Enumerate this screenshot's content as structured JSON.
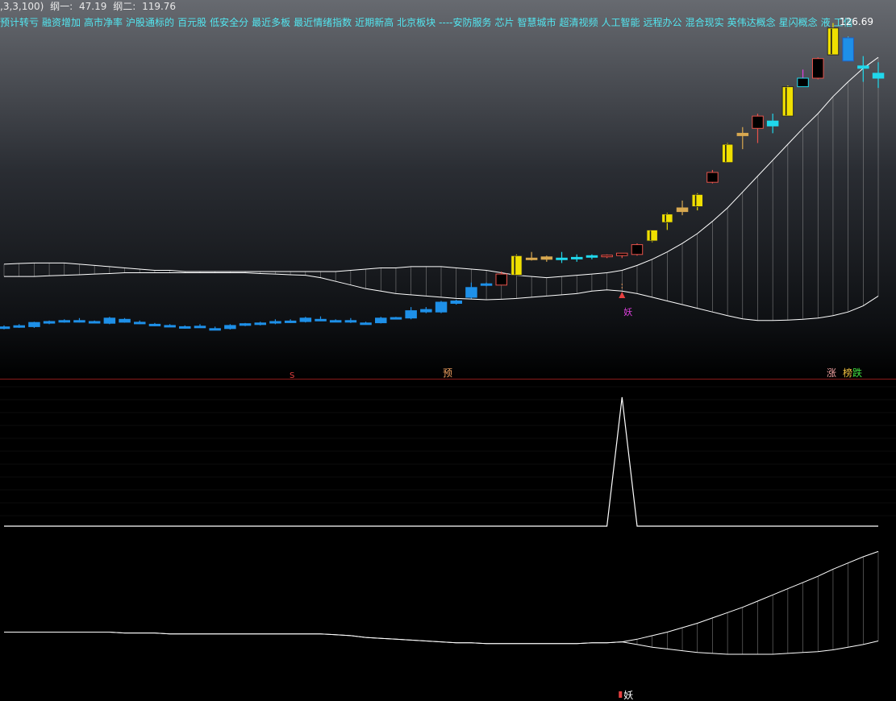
{
  "header": {
    "params": ",3,3,100)",
    "line1_label": "纲一:",
    "line1_value": "47.19",
    "line2_label": "纲二:",
    "line2_value": "119.76"
  },
  "tags": [
    "预计转亏",
    "融资增加",
    "高市净率",
    "沪股通标的",
    "百元股",
    "低安全分",
    "最近多板",
    "最近情绪指数",
    "近期新高",
    "北京板块",
    "----安防服务",
    "芯片",
    "智慧城市",
    "超清视频",
    "人工智能",
    "远程办公",
    "混合现实",
    "英伟达概念",
    "星闪概念",
    "液",
    "工信"
  ],
  "colors": {
    "up_candle": "#f0e000",
    "down_candle": "#e8524a",
    "pre_candle": "#1e90e8",
    "cyan_candle": "#20d8ec",
    "tan_candle": "#d8a850",
    "band_line": "#ffffff",
    "marker_magenta": "#e040e0",
    "marker_red": "#e84040",
    "marker_orange": "#f0a060"
  },
  "markers": {
    "yao_main": "妖",
    "s": "S",
    "yu": "预",
    "zhang": "涨",
    "bang": "榜",
    "die": "跌",
    "yao_bottom": "妖",
    "price_label": "126.69"
  },
  "chart_data": [
    {
      "type": "candlestick",
      "panel": "main",
      "ylim": [
        0,
        130
      ],
      "candles": [
        {
          "o": 7.6,
          "h": 8.6,
          "l": 7.0,
          "c": 8.0,
          "style": "pre"
        },
        {
          "o": 8.1,
          "h": 9.1,
          "l": 7.6,
          "c": 8.5,
          "style": "pre"
        },
        {
          "o": 8.1,
          "h": 10.1,
          "l": 7.6,
          "c": 9.8,
          "style": "pre"
        },
        {
          "o": 9.5,
          "h": 10.6,
          "l": 9.1,
          "c": 10.2,
          "style": "pre"
        },
        {
          "o": 10.2,
          "h": 11.1,
          "l": 9.7,
          "c": 10.6,
          "style": "pre"
        },
        {
          "o": 10.6,
          "h": 11.6,
          "l": 9.8,
          "c": 10.0,
          "style": "pre"
        },
        {
          "o": 9.9,
          "h": 10.6,
          "l": 9.5,
          "c": 10.2,
          "style": "pre"
        },
        {
          "o": 9.5,
          "h": 12.1,
          "l": 9.1,
          "c": 11.6,
          "style": "pre"
        },
        {
          "o": 9.9,
          "h": 11.6,
          "l": 9.7,
          "c": 11.1,
          "style": "pre"
        },
        {
          "o": 9.7,
          "h": 10.6,
          "l": 9.1,
          "c": 9.9,
          "style": "pre"
        },
        {
          "o": 9.1,
          "h": 9.6,
          "l": 8.3,
          "c": 8.6,
          "style": "pre"
        },
        {
          "o": 8.6,
          "h": 9.1,
          "l": 7.9,
          "c": 8.1,
          "style": "pre"
        },
        {
          "o": 7.9,
          "h": 8.6,
          "l": 7.3,
          "c": 8.1,
          "style": "pre"
        },
        {
          "o": 8.3,
          "h": 9.1,
          "l": 7.6,
          "c": 7.9,
          "style": "pre"
        },
        {
          "o": 7.1,
          "h": 8.1,
          "l": 6.6,
          "c": 7.3,
          "style": "pre"
        },
        {
          "o": 7.3,
          "h": 9.1,
          "l": 6.9,
          "c": 8.6,
          "style": "pre"
        },
        {
          "o": 8.6,
          "h": 9.6,
          "l": 8.3,
          "c": 9.3,
          "style": "pre"
        },
        {
          "o": 9.1,
          "h": 10.1,
          "l": 8.6,
          "c": 9.6,
          "style": "pre"
        },
        {
          "o": 9.7,
          "h": 11.1,
          "l": 9.1,
          "c": 10.2,
          "style": "pre"
        },
        {
          "o": 10.1,
          "h": 11.1,
          "l": 9.6,
          "c": 10.4,
          "style": "pre"
        },
        {
          "o": 10.2,
          "h": 12.1,
          "l": 9.8,
          "c": 11.6,
          "style": "pre"
        },
        {
          "o": 10.9,
          "h": 12.3,
          "l": 10.4,
          "c": 11.1,
          "style": "pre"
        },
        {
          "o": 10.4,
          "h": 11.1,
          "l": 10.1,
          "c": 10.6,
          "style": "pre"
        },
        {
          "o": 10.1,
          "h": 11.6,
          "l": 9.6,
          "c": 10.6,
          "style": "pre"
        },
        {
          "o": 9.4,
          "h": 10.1,
          "l": 9.1,
          "c": 9.6,
          "style": "pre"
        },
        {
          "o": 9.7,
          "h": 12.1,
          "l": 9.4,
          "c": 11.6,
          "style": "pre"
        },
        {
          "o": 11.6,
          "h": 12.1,
          "l": 11.1,
          "c": 11.8,
          "style": "pre"
        },
        {
          "o": 11.6,
          "h": 16.1,
          "l": 11.1,
          "c": 14.6,
          "style": "pre"
        },
        {
          "o": 14.1,
          "h": 16.1,
          "l": 13.6,
          "c": 15.1,
          "style": "pre"
        },
        {
          "o": 14.1,
          "h": 18.6,
          "l": 13.6,
          "c": 18.1,
          "style": "pre"
        },
        {
          "o": 17.6,
          "h": 19.1,
          "l": 17.1,
          "c": 18.6,
          "style": "pre"
        },
        {
          "o": 20.1,
          "h": 26.1,
          "l": 19.6,
          "c": 24.1,
          "style": "pre"
        },
        {
          "o": 25.1,
          "h": 26.1,
          "l": 24.6,
          "c": 25.6,
          "style": "pre"
        },
        {
          "o": 25.1,
          "h": 30.6,
          "l": 25.1,
          "c": 29.6,
          "style": "down"
        },
        {
          "o": 29.1,
          "h": 37.6,
          "l": 29.1,
          "c": 37.1,
          "style": "up"
        },
        {
          "o": 36.1,
          "h": 38.6,
          "l": 35.1,
          "c": 36.1,
          "style": "tan"
        },
        {
          "o": 35.6,
          "h": 37.1,
          "l": 34.6,
          "c": 36.6,
          "style": "tan"
        },
        {
          "o": 36.1,
          "h": 38.6,
          "l": 34.1,
          "c": 35.6,
          "style": "cyan"
        },
        {
          "o": 35.9,
          "h": 37.6,
          "l": 34.6,
          "c": 36.4,
          "style": "cyan"
        },
        {
          "o": 36.6,
          "h": 37.6,
          "l": 35.6,
          "c": 37.1,
          "style": "cyan"
        },
        {
          "o": 36.8,
          "h": 37.6,
          "l": 36.1,
          "c": 37.3,
          "style": "down"
        },
        {
          "o": 37.1,
          "h": 38.1,
          "l": 36.1,
          "c": 38.1,
          "style": "down"
        },
        {
          "o": 37.6,
          "h": 42.1,
          "l": 37.1,
          "c": 41.6,
          "style": "down"
        },
        {
          "o": 43.1,
          "h": 47.6,
          "l": 42.6,
          "c": 47.6,
          "style": "up"
        },
        {
          "o": 50.6,
          "h": 54.6,
          "l": 47.6,
          "c": 54.1,
          "style": "up"
        },
        {
          "o": 55.1,
          "h": 59.6,
          "l": 53.6,
          "c": 56.6,
          "style": "tan"
        },
        {
          "o": 57.1,
          "h": 62.6,
          "l": 55.6,
          "c": 62.1,
          "style": "up"
        },
        {
          "o": 67.1,
          "h": 72.1,
          "l": 66.6,
          "c": 71.1,
          "style": "down"
        },
        {
          "o": 75.1,
          "h": 83.1,
          "l": 75.1,
          "c": 82.6,
          "style": "up"
        },
        {
          "o": 86.1,
          "h": 89.6,
          "l": 80.6,
          "c": 87.1,
          "style": "tan"
        },
        {
          "o": 89.1,
          "h": 95.1,
          "l": 83.1,
          "c": 94.1,
          "style": "down"
        },
        {
          "o": 90.1,
          "h": 95.1,
          "l": 87.1,
          "c": 92.1,
          "style": "cyan"
        },
        {
          "o": 94.1,
          "h": 106.6,
          "l": 94.1,
          "c": 106.1,
          "style": "up"
        },
        {
          "o": 106.1,
          "h": 113.1,
          "l": 106.1,
          "c": 109.6,
          "style": "cyan_box"
        },
        {
          "o": 109.6,
          "h": 118.1,
          "l": 109.1,
          "c": 117.6,
          "style": "down"
        },
        {
          "o": 119.1,
          "h": 132.1,
          "l": 119.1,
          "c": 130.1,
          "style": "up"
        },
        {
          "o": 126.1,
          "h": 126.6,
          "l": 116.6,
          "c": 116.6,
          "style": "blue_down"
        },
        {
          "o": 114.6,
          "h": 118.6,
          "l": 108.1,
          "c": 113.6,
          "style": "cyan"
        },
        {
          "o": 111.6,
          "h": 116.1,
          "l": 105.6,
          "c": 109.6,
          "style": "cyan"
        }
      ]
    },
    {
      "type": "line",
      "panel": "main",
      "series": [
        {
          "values": [
            33.6,
            33.9,
            34.1,
            34.1,
            34.1,
            33.6,
            33.1,
            32.6,
            32.1,
            31.6,
            31.1,
            31.1,
            30.6,
            30.6,
            30.6,
            30.6,
            30.6,
            30.6,
            30.6,
            30.6,
            30.6,
            30.6,
            30.6,
            31.1,
            31.6,
            32.1,
            32.1,
            32.6,
            32.6,
            32.6,
            32.1,
            31.6,
            31.1,
            30.1,
            29.1,
            28.6,
            28.1,
            28.6,
            29.1,
            29.6,
            30.1,
            31.1,
            33.1,
            35.6,
            38.6,
            42.1,
            46.1,
            51.1,
            56.6,
            63.1,
            69.6,
            76.1,
            82.6,
            89.1,
            95.1,
            102.1,
            108.1,
            113.6,
            118.1
          ]
        },
        {
          "values": [
            28.6,
            28.6,
            28.6,
            28.9,
            29.1,
            29.3,
            29.6,
            29.8,
            30.1,
            30.1,
            30.1,
            30.1,
            30.1,
            30.1,
            30.1,
            30.1,
            30.1,
            29.8,
            29.6,
            29.3,
            29.1,
            28.1,
            26.6,
            25.1,
            23.6,
            22.6,
            21.6,
            21.1,
            20.6,
            20.1,
            19.6,
            19.4,
            19.1,
            19.3,
            19.6,
            20.1,
            20.6,
            21.1,
            21.6,
            22.6,
            23.1,
            22.6,
            21.6,
            20.1,
            18.6,
            17.1,
            15.6,
            14.1,
            12.6,
            11.3,
            10.6,
            10.6,
            10.8,
            11.1,
            11.6,
            12.6,
            14.1,
            16.6,
            20.6
          ]
        }
      ]
    },
    {
      "type": "line",
      "panel": "middle",
      "series": [
        {
          "values": [
            0,
            0,
            0,
            0,
            0,
            0,
            0,
            0,
            0,
            0,
            0,
            0,
            0,
            0,
            0,
            0,
            0,
            0,
            0,
            0,
            0,
            0,
            0,
            0,
            0,
            0,
            0,
            0,
            0,
            0,
            0,
            0,
            0,
            0,
            0,
            0,
            0,
            0,
            0,
            0,
            0,
            1,
            0,
            0,
            0,
            0,
            0,
            0,
            0,
            0,
            0,
            0,
            0,
            0,
            0,
            0,
            0,
            0,
            0
          ]
        }
      ]
    },
    {
      "type": "line",
      "panel": "bottom",
      "series": [
        {
          "values": [
            5,
            5,
            5,
            5,
            5,
            5,
            5,
            5,
            4,
            4,
            4,
            3,
            3,
            3,
            3,
            3,
            3,
            3,
            3,
            3,
            3,
            3,
            2,
            1,
            -1,
            -2,
            -3,
            -4,
            -5,
            -6,
            -7,
            -7,
            -8,
            -8,
            -8,
            -8,
            -8,
            -8,
            -8,
            -7,
            -7,
            -6,
            -3,
            1,
            5,
            10,
            15,
            21,
            27,
            33,
            40,
            47,
            54,
            61,
            68,
            76,
            83,
            90,
            96
          ]
        },
        {
          "values": [
            5,
            5,
            5,
            5,
            5,
            5,
            5,
            5,
            4,
            4,
            4,
            3,
            3,
            3,
            3,
            3,
            3,
            3,
            3,
            3,
            3,
            3,
            2,
            1,
            -1,
            -2,
            -3,
            -4,
            -5,
            -6,
            -7,
            -7,
            -8,
            -8,
            -8,
            -8,
            -8,
            -8,
            -8,
            -7,
            -7,
            -6,
            -9,
            -12,
            -14,
            -16,
            -18,
            -19,
            -20,
            -20,
            -20,
            -20,
            -19,
            -18,
            -17,
            -15,
            -12,
            -9,
            -5
          ]
        }
      ]
    }
  ]
}
